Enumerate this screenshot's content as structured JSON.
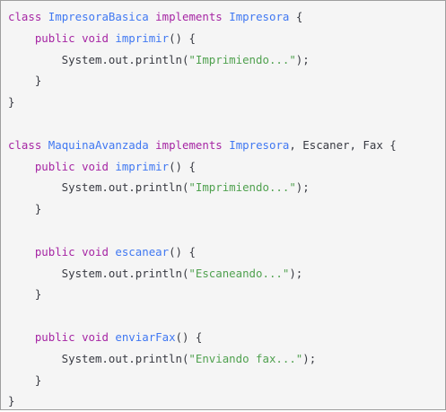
{
  "code": {
    "lines": [
      [
        {
          "t": "class",
          "c": "kw"
        },
        {
          "t": " ",
          "c": "pl"
        },
        {
          "t": "ImpresoraBasica",
          "c": "ty"
        },
        {
          "t": " ",
          "c": "pl"
        },
        {
          "t": "implements",
          "c": "kw"
        },
        {
          "t": " ",
          "c": "pl"
        },
        {
          "t": "Impresora",
          "c": "ty"
        },
        {
          "t": " {",
          "c": "pl"
        }
      ],
      [
        {
          "t": "    ",
          "c": "pl"
        },
        {
          "t": "public",
          "c": "kw"
        },
        {
          "t": " ",
          "c": "pl"
        },
        {
          "t": "void",
          "c": "kw"
        },
        {
          "t": " ",
          "c": "pl"
        },
        {
          "t": "imprimir",
          "c": "fn"
        },
        {
          "t": "() {",
          "c": "pl"
        }
      ],
      [
        {
          "t": "        System.out.println(",
          "c": "pl"
        },
        {
          "t": "\"Imprimiendo...\"",
          "c": "str"
        },
        {
          "t": ");",
          "c": "pl"
        }
      ],
      [
        {
          "t": "    }",
          "c": "pl"
        }
      ],
      [
        {
          "t": "}",
          "c": "pl"
        }
      ],
      [],
      [
        {
          "t": "class",
          "c": "kw"
        },
        {
          "t": " ",
          "c": "pl"
        },
        {
          "t": "MaquinaAvanzada",
          "c": "ty"
        },
        {
          "t": " ",
          "c": "pl"
        },
        {
          "t": "implements",
          "c": "kw"
        },
        {
          "t": " ",
          "c": "pl"
        },
        {
          "t": "Impresora",
          "c": "ty"
        },
        {
          "t": ", Escaner, Fax {",
          "c": "pl"
        }
      ],
      [
        {
          "t": "    ",
          "c": "pl"
        },
        {
          "t": "public",
          "c": "kw"
        },
        {
          "t": " ",
          "c": "pl"
        },
        {
          "t": "void",
          "c": "kw"
        },
        {
          "t": " ",
          "c": "pl"
        },
        {
          "t": "imprimir",
          "c": "fn"
        },
        {
          "t": "() {",
          "c": "pl"
        }
      ],
      [
        {
          "t": "        System.out.println(",
          "c": "pl"
        },
        {
          "t": "\"Imprimiendo...\"",
          "c": "str"
        },
        {
          "t": ");",
          "c": "pl"
        }
      ],
      [
        {
          "t": "    }",
          "c": "pl"
        }
      ],
      [],
      [
        {
          "t": "    ",
          "c": "pl"
        },
        {
          "t": "public",
          "c": "kw"
        },
        {
          "t": " ",
          "c": "pl"
        },
        {
          "t": "void",
          "c": "kw"
        },
        {
          "t": " ",
          "c": "pl"
        },
        {
          "t": "escanear",
          "c": "fn"
        },
        {
          "t": "() {",
          "c": "pl"
        }
      ],
      [
        {
          "t": "        System.out.println(",
          "c": "pl"
        },
        {
          "t": "\"Escaneando...\"",
          "c": "str"
        },
        {
          "t": ");",
          "c": "pl"
        }
      ],
      [
        {
          "t": "    }",
          "c": "pl"
        }
      ],
      [],
      [
        {
          "t": "    ",
          "c": "pl"
        },
        {
          "t": "public",
          "c": "kw"
        },
        {
          "t": " ",
          "c": "pl"
        },
        {
          "t": "void",
          "c": "kw"
        },
        {
          "t": " ",
          "c": "pl"
        },
        {
          "t": "enviarFax",
          "c": "fn"
        },
        {
          "t": "() {",
          "c": "pl"
        }
      ],
      [
        {
          "t": "        System.out.println(",
          "c": "pl"
        },
        {
          "t": "\"Enviando fax...\"",
          "c": "str"
        },
        {
          "t": ");",
          "c": "pl"
        }
      ],
      [
        {
          "t": "    }",
          "c": "pl"
        }
      ],
      [
        {
          "t": "}",
          "c": "pl"
        }
      ]
    ]
  },
  "colors": {
    "background": "#f5f5f5",
    "border": "#9e9e9e",
    "keyword": "#a626a4",
    "type": "#4078f2",
    "string": "#50a14f",
    "plain": "#383a42"
  }
}
